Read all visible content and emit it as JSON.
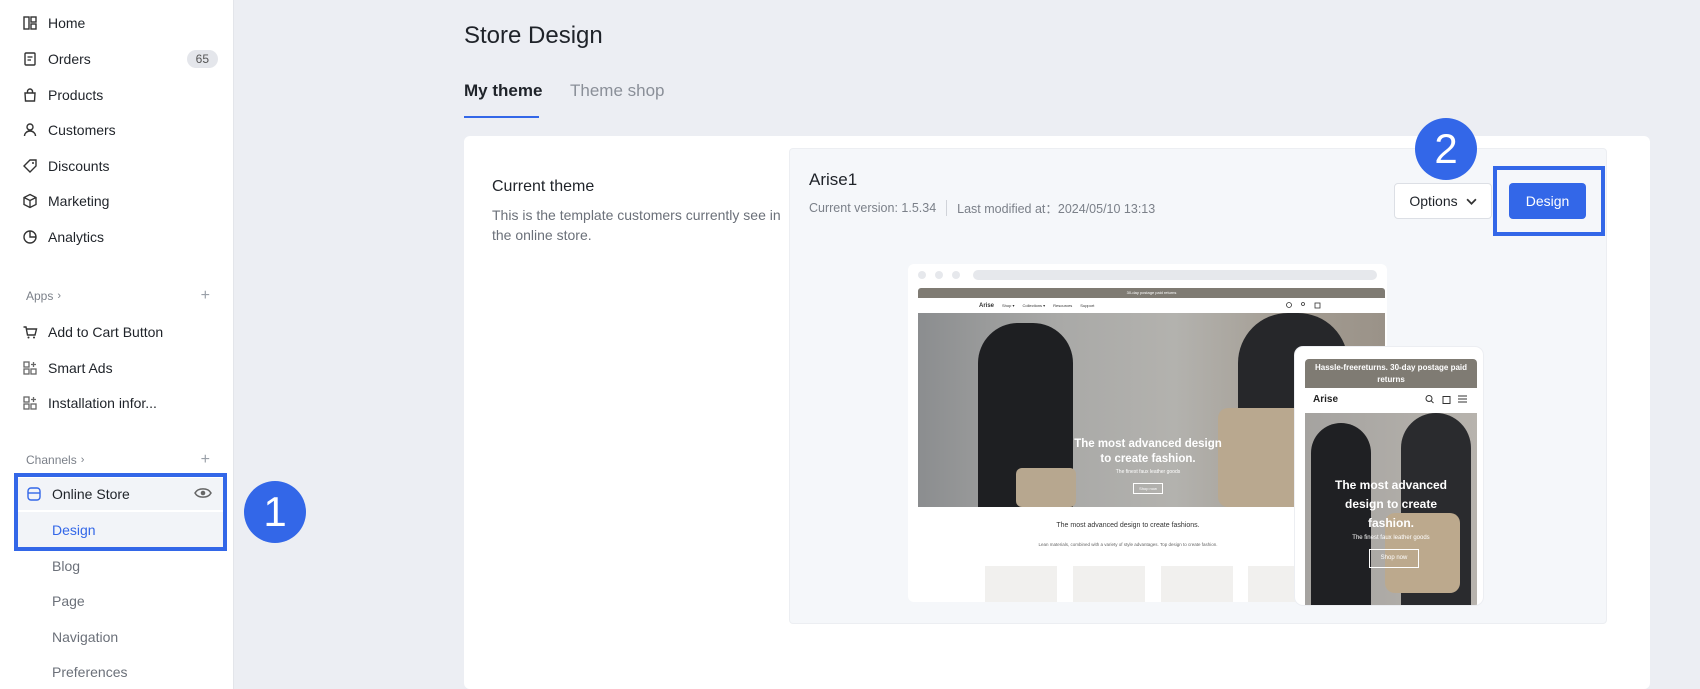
{
  "sidebar": {
    "nav": [
      {
        "label": "Home",
        "icon": "home-icon"
      },
      {
        "label": "Orders",
        "icon": "orders-icon",
        "badge": "65"
      },
      {
        "label": "Products",
        "icon": "products-icon"
      },
      {
        "label": "Customers",
        "icon": "customers-icon"
      },
      {
        "label": "Discounts",
        "icon": "discounts-icon"
      },
      {
        "label": "Marketing",
        "icon": "marketing-icon"
      },
      {
        "label": "Analytics",
        "icon": "analytics-icon"
      }
    ],
    "apps_title": "Apps",
    "apps": [
      {
        "label": "Add to Cart Button",
        "icon": "cart-icon"
      },
      {
        "label": "Smart Ads",
        "icon": "app-grid-icon"
      },
      {
        "label": "Installation infor...",
        "icon": "app-grid-icon"
      }
    ],
    "channels_title": "Channels",
    "online_store": "Online Store",
    "sub_items": [
      "Design",
      "Blog",
      "Page",
      "Navigation",
      "Preferences"
    ]
  },
  "annotations": {
    "step1": "1",
    "step2": "2",
    "accent": "#3367e8"
  },
  "main": {
    "title": "Store Design",
    "tabs": [
      {
        "label": "My theme",
        "active": true
      },
      {
        "label": "Theme shop",
        "active": false
      }
    ],
    "current_theme": {
      "title": "Current theme",
      "desc": "This is the template customers currently see in the online store."
    },
    "theme": {
      "name": "Arise1",
      "version": "Current version: 1.5.34",
      "modified": "Last modified at：2024/05/10 13:13",
      "options_label": "Options",
      "design_label": "Design"
    },
    "preview": {
      "desktop": {
        "announce": "30-day postage paid returns",
        "logo": "Arise",
        "links": [
          "Shop ▾",
          "Collections ▾",
          "Resources",
          "Support"
        ],
        "hero_title": "The most advanced design to create fashion.",
        "hero_sub": "The finest faux leather goods",
        "hero_btn": "Shop now",
        "section_title": "The most advanced design to create fashions.",
        "section_sub": "Lean materials, combined with a variety of style advantages. Top design to create fashion."
      },
      "mobile": {
        "announce": "Hassle-freereturns. 30-day postage paid returns",
        "logo": "Arise",
        "hero_title": "The most advanced design to create fashion.",
        "hero_sub": "The finest faux leather goods",
        "hero_btn": "Shop now"
      }
    }
  }
}
